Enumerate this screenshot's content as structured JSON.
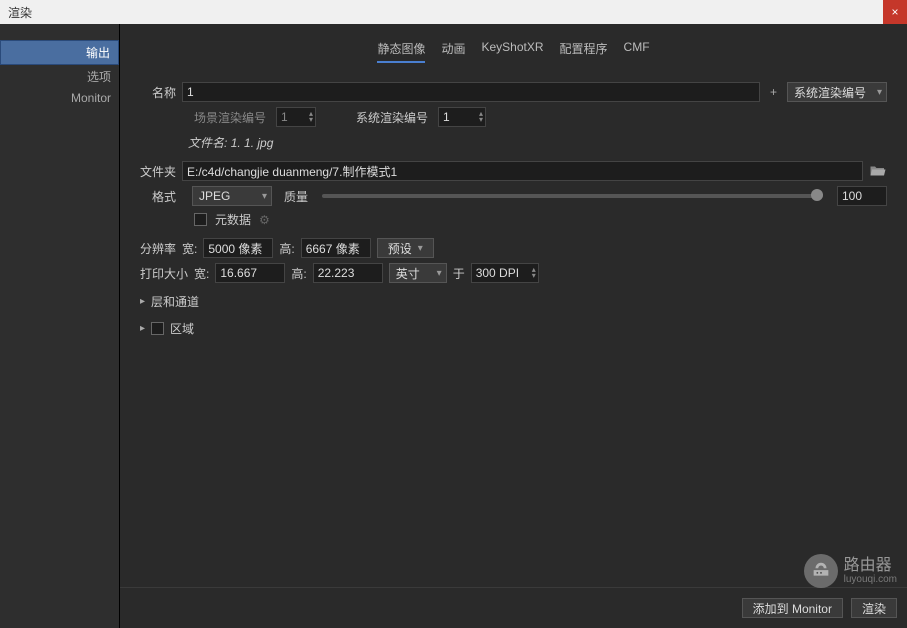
{
  "window": {
    "title": "渲染",
    "close": "×"
  },
  "sidebar": {
    "items": [
      {
        "label": "输出",
        "selected": true
      },
      {
        "label": "选项",
        "selected": false
      },
      {
        "label": "Monitor",
        "selected": false
      }
    ]
  },
  "tabs": [
    "静态图像",
    "动画",
    "KeyShotXR",
    "配置程序",
    "CMF"
  ],
  "active_tab": 0,
  "form": {
    "name_label": "名称",
    "name_value": "1",
    "plus": "+",
    "system_number_label": "系统渲染编号",
    "scene_number_label": "场景渲染编号",
    "scene_number_value": "1",
    "system_render_number_label": "系统渲染编号",
    "system_render_number_value": "1",
    "filename_label": "文件名:",
    "filename_value": "1. 1. jpg",
    "folder_label": "文件夹",
    "folder_value": "E:/c4d/changjie duanmeng/7.制作模式1",
    "format_label": "格式",
    "format_value": "JPEG",
    "quality_label": "质量",
    "quality_value": "100",
    "metadata_label": "元数据",
    "resolution_label": "分辨率",
    "width_label": "宽:",
    "width_value": "5000 像素",
    "height_label": "高:",
    "height_value": "6667 像素",
    "preset_label": "预设",
    "print_label": "打印大小",
    "print_width_value": "16.667",
    "print_height_value": "22.223",
    "unit_value": "英寸",
    "at_label": "于",
    "dpi_value": "300 DPI",
    "layers_label": "层和通道",
    "region_label": "区域"
  },
  "footer": {
    "add_monitor": "添加到 Monitor",
    "render": "渲染"
  },
  "watermark": {
    "title": "路由器",
    "sub": "luyouqi.com"
  }
}
